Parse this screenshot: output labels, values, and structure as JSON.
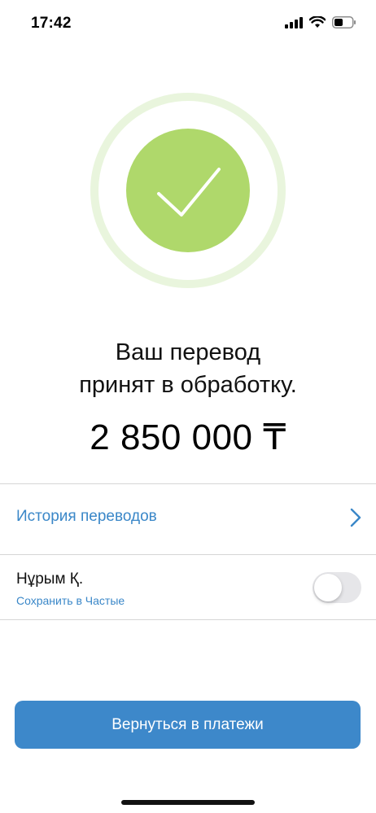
{
  "status_bar": {
    "time": "17:42",
    "icons": [
      "cellular-signal-icon",
      "wifi-icon",
      "battery-icon"
    ]
  },
  "success": {
    "icon": "checkmark-icon",
    "ring_color": "#e9f5dd",
    "circle_color": "#afd86b"
  },
  "message": {
    "line1": "Ваш перевод",
    "line2": "принят в обработку."
  },
  "amount": "2 850 000 ₸",
  "history": {
    "label": "История переводов",
    "icon": "chevron-right-icon"
  },
  "contact": {
    "name": "Нұрым Қ.",
    "save_label": "Сохранить в Частые",
    "save_toggle_on": false
  },
  "actions": {
    "back_label": "Вернуться в платежи"
  },
  "colors": {
    "accent": "#3d88ca",
    "link": "#3a87c8",
    "success": "#afd86b"
  }
}
